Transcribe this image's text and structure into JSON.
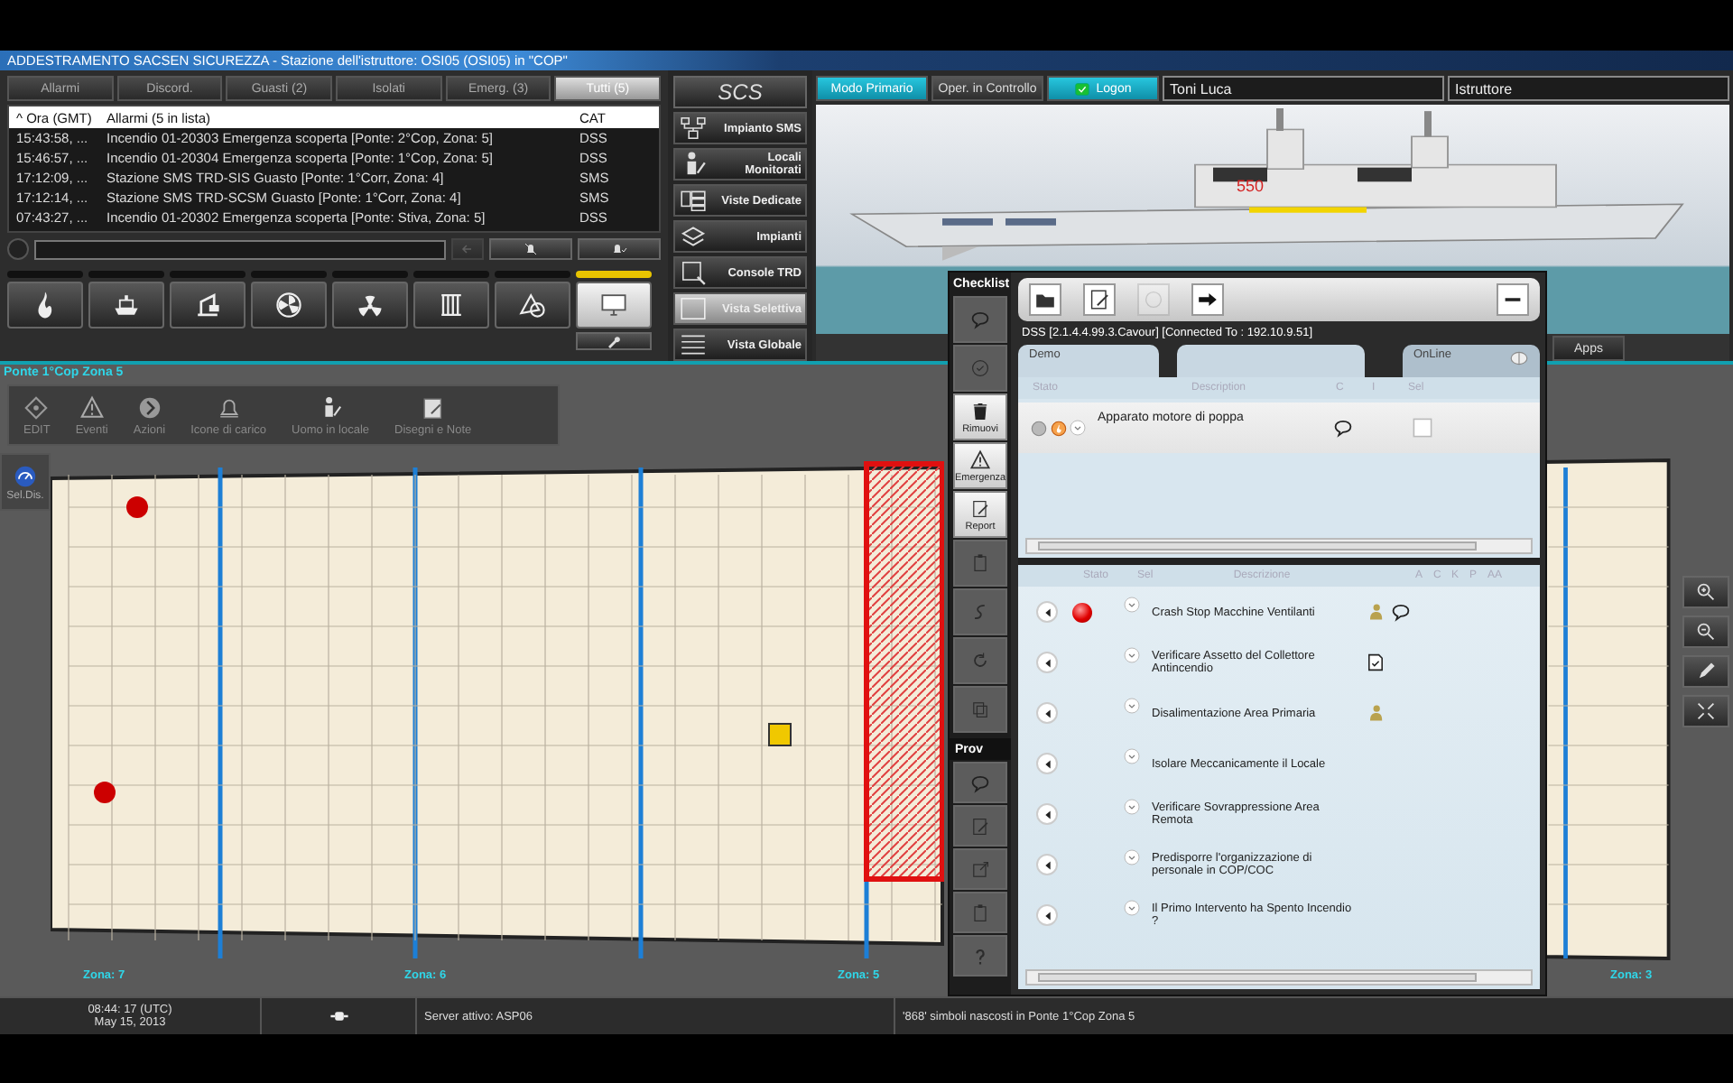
{
  "window": {
    "title": "ADDESTRAMENTO SACSEN SICUREZZA - Stazione dell'istruttore: OSI05 (OSI05) in \"COP\""
  },
  "alarm_tabs": [
    {
      "label": "Allarmi",
      "selected": false
    },
    {
      "label": "Discord.",
      "selected": false
    },
    {
      "label": "Guasti (2)",
      "selected": false
    },
    {
      "label": "Isolati",
      "selected": false
    },
    {
      "label": "Emerg. (3)",
      "selected": false
    },
    {
      "label": "Tutti (5)",
      "selected": true
    }
  ],
  "alarm_table": {
    "columns": [
      "^ Ora (GMT)",
      "Allarmi (5 in lista)",
      "CAT"
    ],
    "rows": [
      {
        "time": "15:43:58, ...",
        "alarm": "Incendio 01-20303 Emergenza scoperta [Ponte: 2°Cop, Zona: 5]",
        "cat": "DSS"
      },
      {
        "time": "15:46:57, ...",
        "alarm": "Incendio 01-20304 Emergenza scoperta [Ponte: 1°Cop, Zona: 5]",
        "cat": "DSS"
      },
      {
        "time": "17:12:09, ...",
        "alarm": "Stazione SMS TRD-SIS Guasto [Ponte: 1°Corr, Zona: 4]",
        "cat": "SMS"
      },
      {
        "time": "17:12:14, ...",
        "alarm": "Stazione SMS TRD-SCSM Guasto [Ponte: 1°Corr, Zona: 4]",
        "cat": "SMS"
      },
      {
        "time": "07:43:27, ...",
        "alarm": "Incendio 01-20302 Emergenza scoperta [Ponte: Stiva, Zona: 5]",
        "cat": "DSS"
      }
    ]
  },
  "category_buttons": [
    {
      "kind": "flame",
      "selected": false
    },
    {
      "kind": "ship",
      "selected": false
    },
    {
      "kind": "crane",
      "selected": false
    },
    {
      "kind": "fan",
      "selected": false
    },
    {
      "kind": "radiation",
      "selected": false
    },
    {
      "kind": "rack",
      "selected": false
    },
    {
      "kind": "shapes",
      "selected": false
    },
    {
      "kind": "monitor",
      "selected": true
    }
  ],
  "scs_menu": {
    "title": "SCS",
    "items": [
      {
        "kind": "network",
        "label": "Impianto SMS",
        "selected": false
      },
      {
        "kind": "person",
        "label": "Locali Monitorati",
        "selected": false
      },
      {
        "kind": "panels",
        "label": "Viste Dedicate",
        "selected": false
      },
      {
        "kind": "layers",
        "label": "Impianti",
        "selected": false
      },
      {
        "kind": "console",
        "label": "Console TRD",
        "selected": false
      },
      {
        "kind": "frame",
        "label": "Vista Selettiva",
        "selected": true
      },
      {
        "kind": "lines",
        "label": "Vista Globale",
        "selected": false
      }
    ]
  },
  "mode_buttons": [
    {
      "label": "Modo Primario",
      "active": true
    },
    {
      "label": "Oper. in Controllo",
      "active": false
    },
    {
      "label": "Logon",
      "active": true
    }
  ],
  "operator_field": {
    "value": "Toni Luca"
  },
  "role_field": {
    "value": "Istruttore"
  },
  "ship_view": {
    "hull_number": "550",
    "apps_button": "Apps"
  },
  "deck_map": {
    "location": "Ponte 1°Cop Zona 5",
    "tools": [
      {
        "kind": "edit",
        "label": "EDIT"
      },
      {
        "kind": "warning",
        "label": "Eventi"
      },
      {
        "kind": "chevron",
        "label": "Azioni"
      },
      {
        "kind": "bell",
        "label": "Icone di carico"
      },
      {
        "kind": "person",
        "label": "Uomo in locale"
      },
      {
        "kind": "notes",
        "label": "Disegni e Note"
      }
    ],
    "side_button": "Sel.Dis.",
    "zones": [
      "Zona: 7",
      "Zona: 6",
      "Zona: 5",
      "Zona: 3"
    ]
  },
  "checklist": {
    "title": "Checklist",
    "side_buttons": [
      {
        "kind": "comment",
        "disabled": true
      },
      {
        "kind": "check",
        "disabled": true
      },
      {
        "kind": "trash",
        "label": "Rimuovi",
        "disabled": false
      },
      {
        "kind": "warning",
        "label": "Emergenza",
        "disabled": false
      },
      {
        "kind": "report",
        "label": "Report",
        "disabled": false
      },
      {
        "kind": "clipboard",
        "disabled": true
      },
      {
        "kind": "swirl",
        "disabled": true
      },
      {
        "kind": "refresh",
        "disabled": true
      },
      {
        "kind": "copy",
        "disabled": true
      }
    ],
    "section": "Prov",
    "section_buttons": [
      {
        "kind": "comment",
        "disabled": true
      },
      {
        "kind": "edit",
        "disabled": true
      },
      {
        "kind": "export",
        "disabled": true
      },
      {
        "kind": "clipboard",
        "disabled": true
      },
      {
        "kind": "question",
        "disabled": true
      }
    ],
    "connection": "DSS [2.1.4.4.99.3.Cavour] [Connected To : 192.10.9.51]",
    "tabs": [
      {
        "label": "Demo",
        "selected": true
      },
      {
        "label": "OnLine",
        "selected": false
      }
    ],
    "upper_columns": [
      "Stato",
      "Description",
      "C",
      "I",
      "Sel"
    ],
    "upper_rows": [
      {
        "description": "Apparato motore di poppa",
        "alarm": true
      }
    ],
    "lower_columns": [
      "Stato",
      "Sel",
      "Descrizione",
      "A",
      "C",
      "K",
      "P",
      "AA"
    ],
    "steps": [
      {
        "text": "Crash Stop Macchine Ventilanti",
        "alarm": true,
        "assigned": true,
        "commented": true
      },
      {
        "text": "Verificare Assetto del Collettore Antincendio",
        "noted": true
      },
      {
        "text": "Disalimentazione Area Primaria",
        "assigned": true
      },
      {
        "text": "Isolare Meccanicamente il Locale"
      },
      {
        "text": "Verificare Sovrappressione Area Remota"
      },
      {
        "text": "Predisporre l'organizzazione di personale in COP/COC"
      },
      {
        "text": "Il Primo Intervento ha Spento Incendio ?"
      }
    ]
  },
  "status_bar": {
    "time": "08:44: 17 (UTC)",
    "date": "May 15, 2013",
    "server": "Server attivo: ASP06",
    "hidden_symbols": "'868' simboli nascosti in Ponte 1°Cop Zona 5"
  }
}
